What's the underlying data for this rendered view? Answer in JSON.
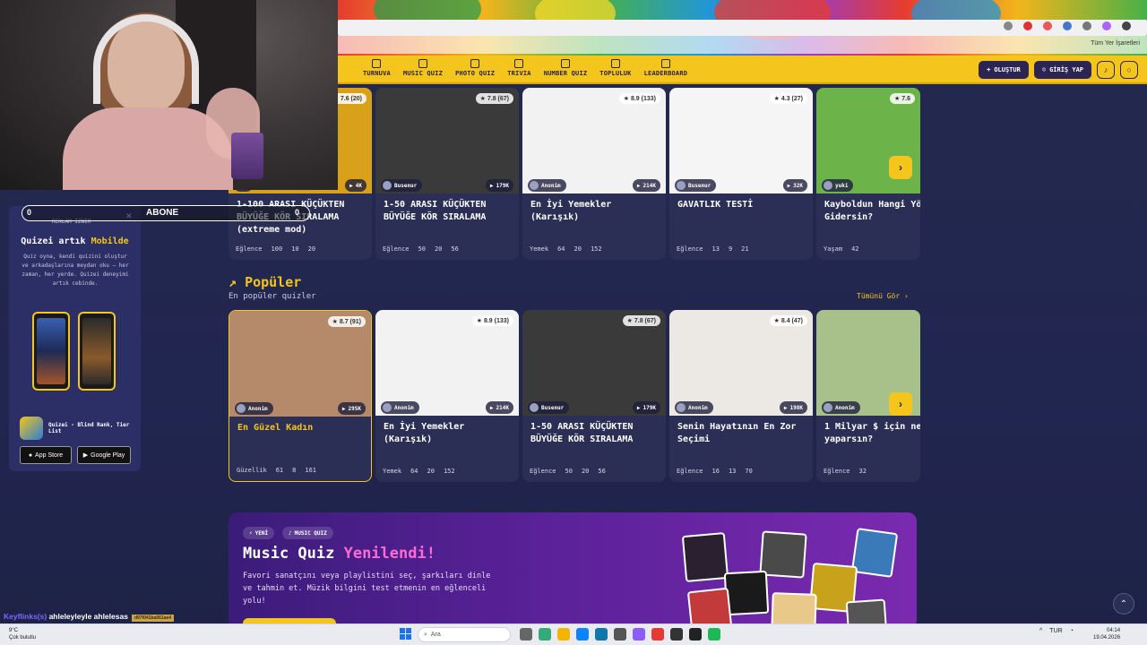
{
  "stream": {
    "abone_count_left": "0",
    "abone_label": "ABONE",
    "abone_count_right": "0",
    "chat_user": "Keyflinks(s)",
    "chat_message": "ahleleyleyle ahlelesas",
    "chat_tag": "d97f041ba061ae4"
  },
  "browser": {
    "bookmarks_label": "Tüm Yer İşaretleri"
  },
  "nav": {
    "items": [
      "TURNUVA",
      "MUSIC QUIZ",
      "PHOTO QUIZ",
      "TRIVIA",
      "NUMBER QUIZ",
      "TOPLULUK",
      "LEADERBOARD"
    ],
    "create_label": "OLUŞTUR",
    "login_label": "GİRİŞ YAP"
  },
  "promo": {
    "ad_label": "REKLAM İZNİM",
    "title_a": "Quizei artık ",
    "title_b": "Mobilde",
    "description": "Quiz oyna, kendi quizini oluştur ve arkadaşlarına meydan oku — her zaman, her yerde. Quizei deneyimi artık cebinde.",
    "app_name": "Quizei - Blind Rank, Tier List",
    "app_store": "App Store",
    "google_play": "Google Play"
  },
  "top_cards": [
    {
      "title": "1-100 ARASI KÜÇÜKTEN BÜYÜĞE KÖR SIRALAMA (extreme mod)",
      "author": "",
      "plays": "4K",
      "rating": "7.6 (20)",
      "category": "Eğlence",
      "questions": "100",
      "comments": "10",
      "likes": "20"
    },
    {
      "title": "1-50 ARASI KÜÇÜKTEN BÜYÜĞE KÖR SIRALAMA",
      "author": "Busenur",
      "plays": "179K",
      "rating": "7.8 (67)",
      "category": "Eğlence",
      "questions": "50",
      "comments": "20",
      "likes": "56"
    },
    {
      "title": "En İyi Yemekler (Karışık)",
      "author": "Anonim",
      "plays": "214K",
      "rating": "8.9 (133)",
      "category": "Yemek",
      "questions": "64",
      "comments": "20",
      "likes": "152"
    },
    {
      "title": "GAVATLIK TESTİ",
      "author": "Busenur",
      "plays": "32K",
      "rating": "4.3 (27)",
      "category": "Eğlence",
      "questions": "13",
      "comments": "9",
      "likes": "21"
    },
    {
      "title": "Kayboldun Hangi Yöne Gidersin?",
      "author": "yuki",
      "plays": "",
      "rating": "7.6",
      "category": "Yaşam",
      "questions": "42",
      "comments": "",
      "likes": ""
    }
  ],
  "popular": {
    "title": "Popüler",
    "subtitle": "En popüler quizler",
    "see_all": "Tümünü Gör ›"
  },
  "pop_cards": [
    {
      "title": "En Güzel Kadın",
      "author": "Anonim",
      "plays": "295K",
      "rating": "8.7 (91)",
      "category": "Güzellik",
      "questions": "61",
      "comments": "8",
      "likes": "161"
    },
    {
      "title": "En İyi Yemekler (Karışık)",
      "author": "Anonim",
      "plays": "214K",
      "rating": "8.9 (133)",
      "category": "Yemek",
      "questions": "64",
      "comments": "20",
      "likes": "152"
    },
    {
      "title": "1-50 ARASI KÜÇÜKTEN BÜYÜĞE KÖR SIRALAMA",
      "author": "Busenur",
      "plays": "179K",
      "rating": "7.8 (67)",
      "category": "Eğlence",
      "questions": "50",
      "comments": "20",
      "likes": "56"
    },
    {
      "title": "Senin Hayatının En Zor Seçimi",
      "author": "Anonim",
      "plays": "198K",
      "rating": "8.4 (47)",
      "category": "Eğlence",
      "questions": "16",
      "comments": "13",
      "likes": "70"
    },
    {
      "title": "1 Milyar $ için ne yaparsın?",
      "author": "Anonim",
      "plays": "",
      "rating": "",
      "category": "Eğlence",
      "questions": "32",
      "comments": "",
      "likes": ""
    }
  ],
  "banner": {
    "pill_new": "YENİ",
    "pill_music": "MUSIC QUIZ",
    "title_a": "Music Quiz ",
    "title_b": "Yenilendi!",
    "description": "Favori sanatçını veya playlistini seç, şarkıları dinle ve tahmin et. Müzik bilgini test etmenin en eğlenceli yolu!"
  },
  "taskbar": {
    "weather_temp": "9°C",
    "weather_text": "Çok bulutlu",
    "search_placeholder": "Ara",
    "time": "04:14",
    "date": "19.04.2026",
    "lang": "TUR"
  }
}
